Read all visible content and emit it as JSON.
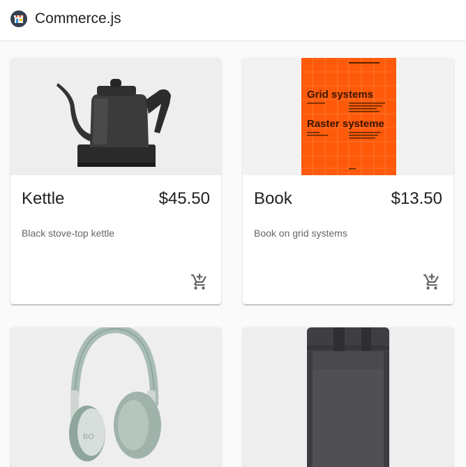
{
  "app": {
    "title": "Commerce.js"
  },
  "products": [
    {
      "name": "Kettle",
      "price": "$45.50",
      "description": "Black stove-top kettle",
      "image_icon": "kettle-image",
      "add_to_cart_icon": "add-shopping-cart-icon"
    },
    {
      "name": "Book",
      "price": "$13.50",
      "description": "Book on grid systems",
      "image_icon": "book-image",
      "cover_title_1": "Grid systems",
      "cover_title_2": "Raster systeme",
      "add_to_cart_icon": "add-shopping-cart-icon"
    },
    {
      "image_icon": "headphones-image",
      "logo_text": "BO"
    },
    {
      "image_icon": "backpack-image"
    }
  ],
  "colors": {
    "book_cover": "#ff5a0a",
    "media_background": "#eeeeee",
    "headphones": "#a9bdb4",
    "backpack": "#4a4a4e"
  }
}
